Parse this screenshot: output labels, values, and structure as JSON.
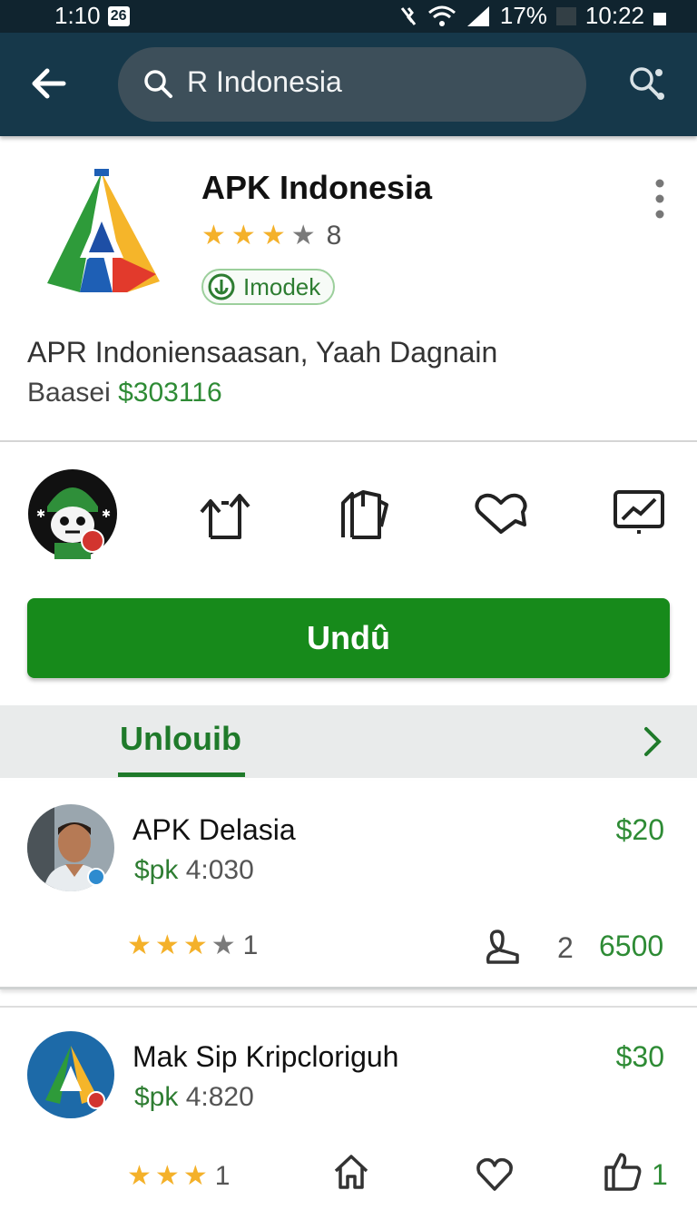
{
  "status_bar": {
    "time_left": "1:10",
    "notif_glyph": "26",
    "battery_percent": "17%",
    "clock": "10:22"
  },
  "search": {
    "query": "R Indonesia"
  },
  "app": {
    "name": "APK Indonesia",
    "rating_stars": 3.5,
    "rating_count": "8",
    "badge": "Imodek",
    "description": "APR Indoniensaasan, Yaah Dagnain",
    "price_prefix": "Baasei",
    "price": "$303116"
  },
  "install_button": {
    "label": "Undû"
  },
  "tab": {
    "label": "Unlouib"
  },
  "list": [
    {
      "title": "APK Delasia",
      "sub_prefix": "$pk",
      "sub_value": "4:030",
      "price": "$20",
      "stars": 3.5,
      "star_count": "1",
      "meta_count": "2",
      "meta_value": "6500"
    },
    {
      "title": "Mak Sip Kripcloriguh",
      "sub_prefix": "$pk",
      "sub_value": "4:820",
      "price": "$30",
      "stars": 2.5,
      "star_count": "1",
      "like_count": "1"
    }
  ],
  "icons": {
    "back": "arrow-left-icon",
    "search": "search-icon",
    "voice": "voice-search-icon",
    "more": "more-vert-icon",
    "share": "share-icon",
    "files": "files-icon",
    "wishlist": "heart-outline-icon",
    "stats": "chart-icon",
    "next": "chevron-right-icon",
    "home": "home-icon",
    "like": "thumb-up-icon"
  },
  "colors": {
    "appbar": "#16384a",
    "primary_green": "#178a1b",
    "accent_green": "#2e8b35",
    "star": "#f4b12a"
  }
}
